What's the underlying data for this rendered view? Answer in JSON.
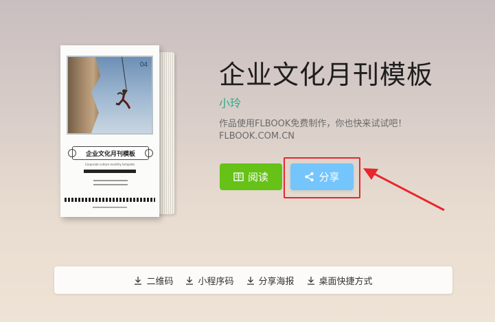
{
  "book": {
    "issue_no": "04",
    "cover_title": "企业文化月刊模板",
    "cover_subtitle": "Corporate culture monthly template"
  },
  "title": "企业文化月刊模板",
  "author": "小玲",
  "description_line1": "作品使用FLBOOK免费制作，你也快来试试吧！",
  "description_line2": "FLBOOK.COM.CN",
  "buttons": {
    "read_label": "阅读",
    "share_label": "分享"
  },
  "bottom_bar": [
    {
      "label": "二维码",
      "icon": "download-icon"
    },
    {
      "label": "小程序码",
      "icon": "download-icon"
    },
    {
      "label": "分享海报",
      "icon": "download-icon"
    },
    {
      "label": "桌面快捷方式",
      "icon": "download-icon"
    }
  ],
  "colors": {
    "read_button": "#66c217",
    "share_button": "#73c5fb",
    "author": "#2fa88c",
    "highlight": "#e8262b"
  }
}
